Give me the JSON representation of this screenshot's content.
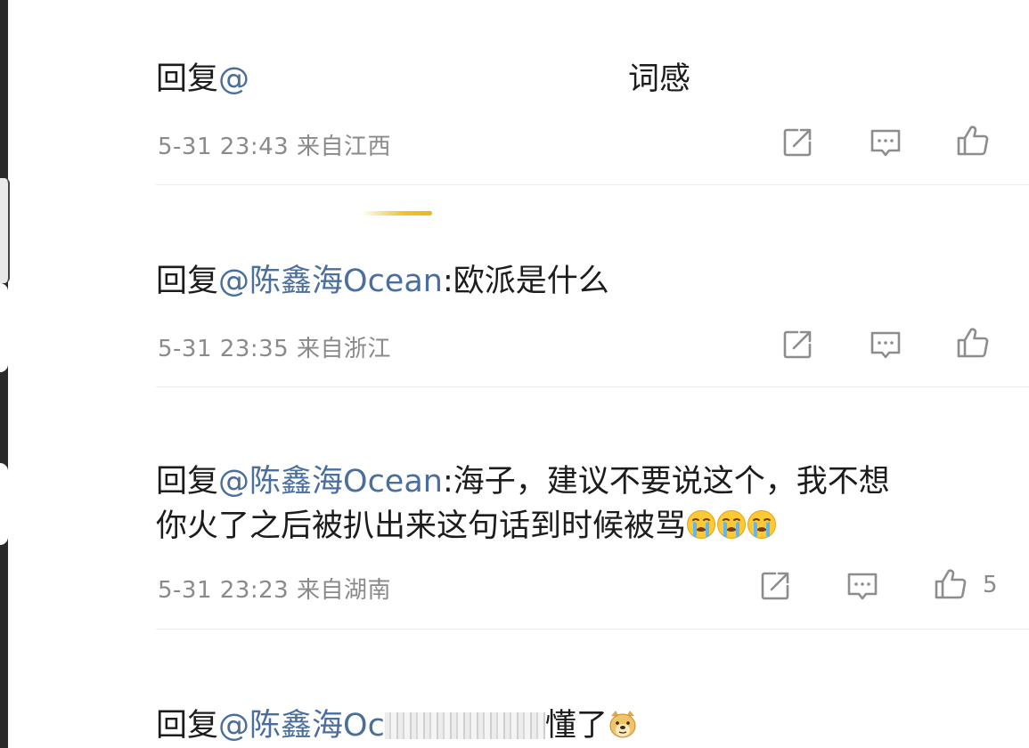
{
  "comments": [
    {
      "prefix": "回复",
      "mention": "@",
      "body": "词感",
      "time": "5-31 23:43",
      "location": "来自江西",
      "likes": ""
    },
    {
      "prefix": "回复",
      "mention": "@陈鑫海Ocean",
      "body": ":欧派是什么",
      "time": "5-31 23:35",
      "location": "来自浙江",
      "likes": ""
    },
    {
      "prefix": "回复",
      "mention": "@陈鑫海Ocean",
      "body": ":海子，建议不要说这个，我不想",
      "body2": "你火了之后被扒出来这句话到时候被骂",
      "time": "5-31 23:23",
      "location": "来自湖南",
      "likes": "5"
    },
    {
      "prefix": "回复",
      "mention": "@陈鑫海Oc",
      "body": "懂了"
    }
  ],
  "icons": {
    "share": "share-icon",
    "comment": "comment-icon",
    "like": "thumbs-up-icon",
    "crying": "crying-emoji-icon",
    "doge": "doge-emoji-icon"
  },
  "colors": {
    "mention": "#4a6e9e",
    "text": "#1c1c1c",
    "meta": "#8a8a8a"
  }
}
